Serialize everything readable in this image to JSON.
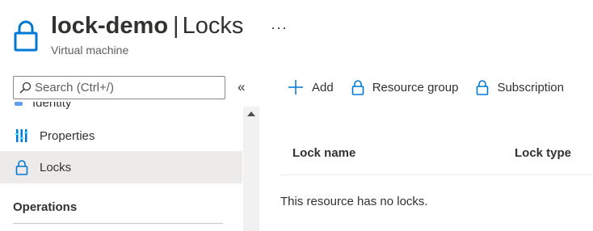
{
  "header": {
    "resource_name": "lock-demo",
    "separator": "|",
    "page_title": "Locks",
    "subtitle": "Virtual machine",
    "more_label": "···",
    "icon": "lock-icon"
  },
  "sidebar": {
    "search_placeholder": "Search (Ctrl+/)",
    "collapse_label": "«",
    "partial_item": {
      "label": "Identity",
      "icon": "identity-icon"
    },
    "items": [
      {
        "label": "Properties",
        "icon": "properties-icon",
        "selected": false
      },
      {
        "label": "Locks",
        "icon": "lock-icon",
        "selected": true
      }
    ],
    "section_header": "Operations"
  },
  "toolbar": {
    "add_label": "Add",
    "resource_group_label": "Resource group",
    "subscription_label": "Subscription"
  },
  "table": {
    "columns": [
      "Lock name",
      "Lock type"
    ],
    "empty_message": "This resource has no locks."
  },
  "colors": {
    "accent": "#0078d4",
    "selected_bg": "#edebe9",
    "text": "#323130"
  }
}
